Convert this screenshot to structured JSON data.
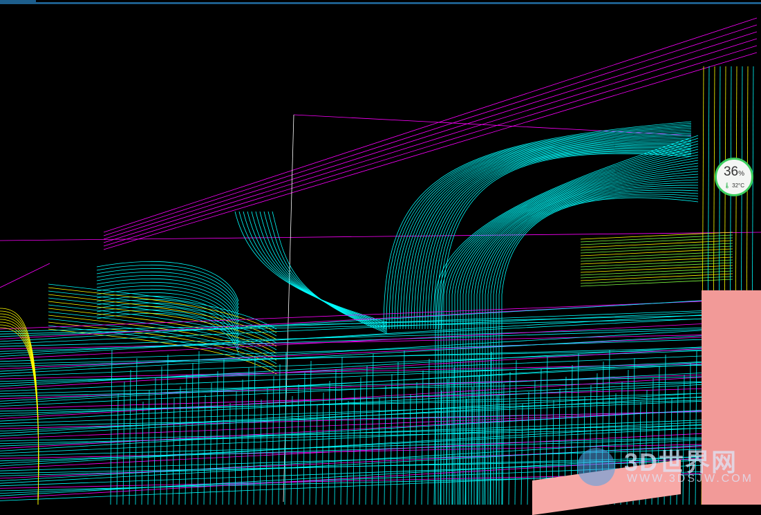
{
  "window": {
    "title_bar_accent": "#1d5e8c"
  },
  "viewport": {
    "background": "#000000",
    "colors": {
      "magenta": "#ff00ff",
      "cyan": "#00ffff",
      "yellow": "#ffff00",
      "white": "#ffffff",
      "pink": "#f29a98"
    }
  },
  "monitor_widget": {
    "percent": "36",
    "percent_sign": "%",
    "temperature": "32°C",
    "icon": "thermometer-icon"
  },
  "watermark": {
    "name": "3D世界网",
    "url": "WWW.3DSJW.COM"
  }
}
